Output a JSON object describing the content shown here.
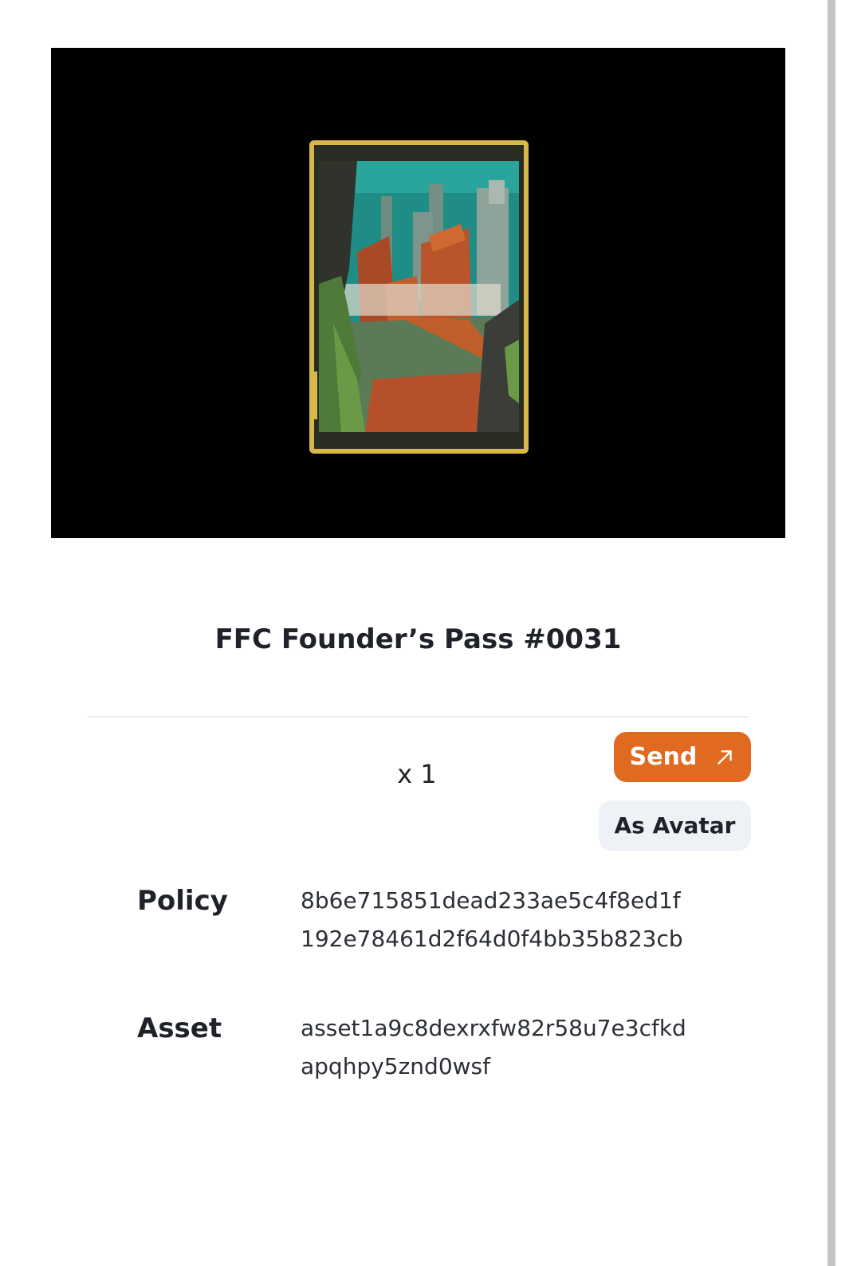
{
  "asset": {
    "title": "FFC Founder’s Pass #0031",
    "quantity": "x 1"
  },
  "actions": {
    "send_label": "Send",
    "avatar_label": "As Avatar"
  },
  "details": {
    "policy_label": "Policy",
    "policy_lines": [
      "8b6e715851dead233ae5c4f8ed1f",
      "192e78461d2f64d0f4bb35b823cb"
    ],
    "asset_label": "Asset",
    "asset_lines": [
      "asset1a9c8dexrxfw82r58u7e3cfkd",
      "apqhpy5znd0wsf"
    ]
  },
  "colors": {
    "send_button": "#e06b20",
    "avatar_button": "#eef2f6",
    "card_frame": "#d9b84a",
    "preview_background": "#000000"
  }
}
